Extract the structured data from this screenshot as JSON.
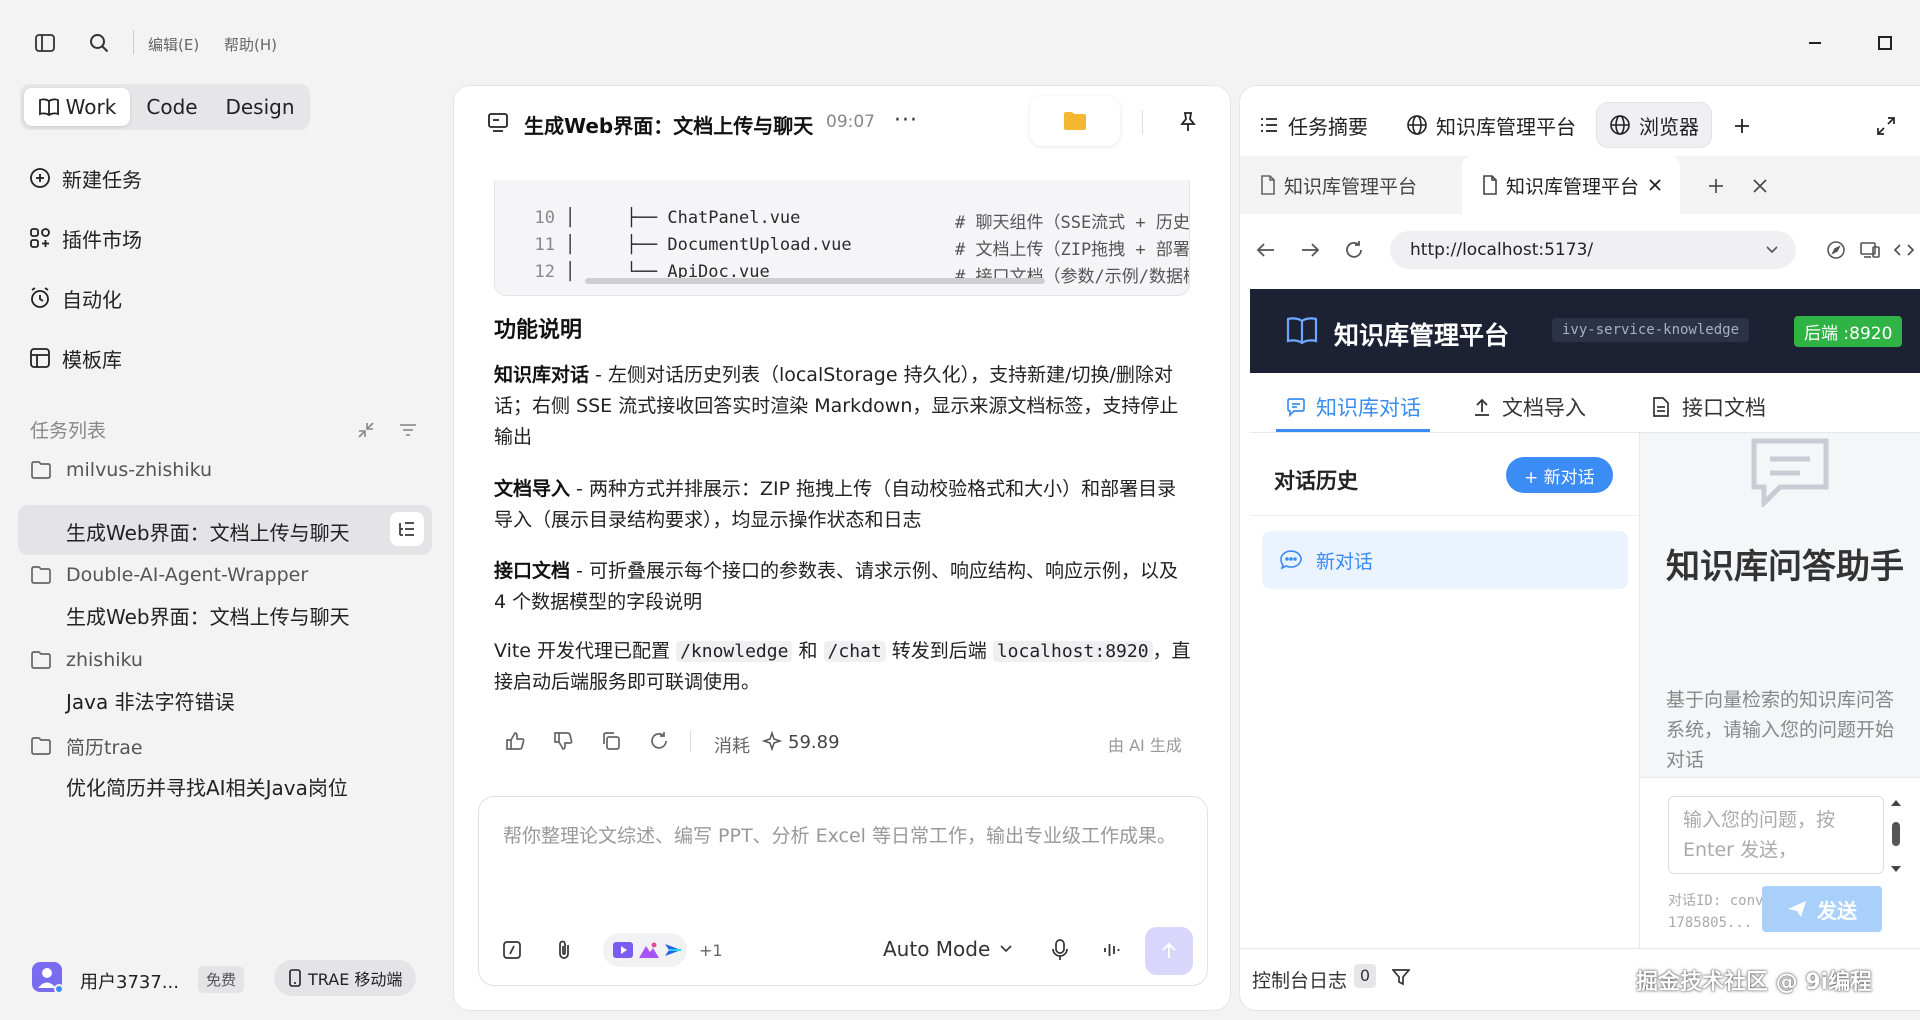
{
  "menu": {
    "edit": "编辑(E)",
    "help": "帮助(H)"
  },
  "modes": [
    "Work",
    "Code",
    "Design"
  ],
  "sidebar": {
    "nav": [
      "新建任务",
      "插件市场",
      "自动化",
      "模板库"
    ],
    "task_list_label": "任务列表",
    "groups": [
      {
        "folder": "milvus-zhishiku",
        "tasks": [
          "生成Web界面：文档上传与聊天"
        ]
      },
      {
        "folder": "Double-AI-Agent-Wrapper",
        "tasks": [
          "生成Web界面：文档上传与聊天"
        ]
      },
      {
        "folder": "zhishiku",
        "tasks": [
          "Java 非法字符错误"
        ]
      },
      {
        "folder": "简历trae",
        "tasks": [
          "优化简历并寻找AI相关Java岗位"
        ]
      }
    ],
    "user": {
      "name": "用户3737...",
      "plan": "免费",
      "mobile": "TRAE 移动端"
    }
  },
  "chat": {
    "title": "生成Web界面：文档上传与聊天",
    "time": "09:07",
    "code_lines": [
      {
        "ln": "10",
        "tree": "│     ├── ChatPanel.vue",
        "comment": "# 聊天组件（SSE流式 + 历史"
      },
      {
        "ln": "11",
        "tree": "│     ├── DocumentUpload.vue",
        "comment": "# 文档上传（ZIP拖拽 + 部署"
      },
      {
        "ln": "12",
        "tree": "│     └── ApiDoc.vue",
        "comment": "# 接口文档（参数/示例/数据模"
      }
    ],
    "section_title": "功能说明",
    "features": [
      {
        "name": "知识库对话",
        "desc": " - 左侧对话历史列表（localStorage 持久化），支持新建/切换/删除对话；右侧 SSE 流式接收回答实时渲染 Markdown，显示来源文档标签，支持停止输出"
      },
      {
        "name": "文档导入",
        "desc": " - 两种方式并排展示：ZIP 拖拽上传（自动校验格式和大小）和部署目录导入（展示目录结构要求），均显示操作状态和日志"
      },
      {
        "name": "接口文档",
        "desc": " - 可折叠展示每个接口的参数表、请求示例、响应结构、响应示例，以及 4 个数据模型的字段说明"
      }
    ],
    "vite": {
      "p1": "Vite 开发代理已配置 ",
      "c1": "/knowledge",
      "p2": " 和 ",
      "c2": "/chat",
      "p3": " 转发到后端 ",
      "c3": "localhost:8920",
      "p4": "，直接启动后端服务即可联调使用。"
    },
    "cost_label": "消耗",
    "cost_value": "59.89",
    "ai_label": "由 AI 生成",
    "composer_placeholder": "帮你整理论文综述、编写 PPT、分析 Excel 等日常工作，输出专业级工作成果。",
    "plus_count": "+1",
    "mode": "Auto Mode"
  },
  "right": {
    "tabs": [
      "任务摘要",
      "知识库管理平台",
      "浏览器"
    ],
    "browser_tabs": [
      "知识库管理平台",
      "知识库管理平台"
    ],
    "url": "http://localhost:5173/",
    "app": {
      "title": "知识库管理平台",
      "service": "ivy-service-knowledge",
      "backend": "后端 :8920",
      "tabs": [
        "知识库对话",
        "文档导入",
        "接口文档"
      ],
      "history_label": "对话历史",
      "new_chat_btn": "+ 新对话",
      "conversation": "新对话",
      "assistant_title": "知识库问答助手",
      "assistant_desc": "基于向量检索的知识库问答系统，请输入您的问题开始对话",
      "input_placeholder": "输入您的问题，按 Enter 发送，",
      "conv_id": "对话ID: conv-1785805...",
      "send": "发送"
    },
    "console_label": "控制台日志",
    "console_count": "0"
  },
  "watermark": "掘金技术社区 @ 9i编程",
  "colors": {
    "accent": "#3b8cf5",
    "dark_header": "#1c2233",
    "green_badge": "#2fb344"
  }
}
